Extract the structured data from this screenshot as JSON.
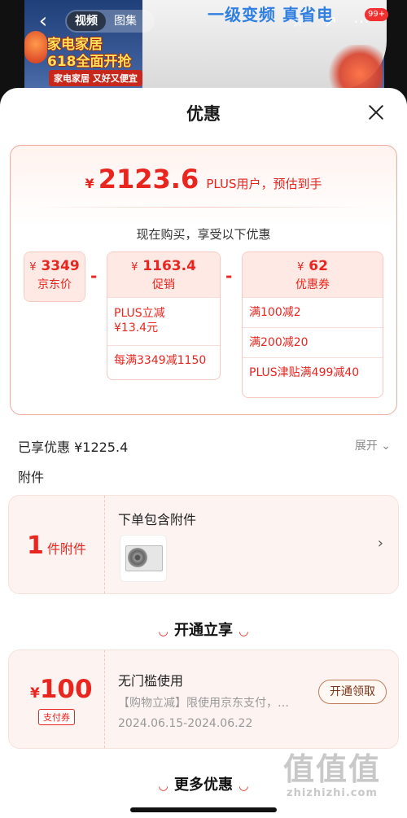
{
  "banner": {
    "slogan": "一级变频  真省电",
    "promo_line1": "家电家居",
    "promo_line2": "618全面开抢",
    "promo_line3": "家电家居  又好又便宜",
    "tab_video": "视频",
    "tab_gallery": "图集",
    "badge_count": "99+"
  },
  "sheet": {
    "title": "优惠"
  },
  "price": {
    "currency": "¥",
    "final": "2123.6",
    "final_tip": "PLUS用户，预估到手",
    "now_buy": "现在购买，享受以下优惠",
    "op_minus": "-",
    "jd": {
      "currency": "¥",
      "value": "3349",
      "label": "京东价"
    },
    "promo": {
      "currency": "¥",
      "value": "1163.4",
      "label": "促销",
      "items": [
        "PLUS立减\n¥13.4元",
        "每满3349减1150"
      ]
    },
    "coupon": {
      "currency": "¥",
      "value": "62",
      "label": "优惠券",
      "items": [
        "满100减2",
        "满200减20",
        "PLUS津贴满499减40"
      ]
    }
  },
  "enjoyed": "已享优惠 ¥1225.4",
  "expand": "展开",
  "attachments": {
    "section_title": "附件",
    "count": "1",
    "count_unit": "件附件",
    "title": "下单包含附件"
  },
  "plus_section": {
    "title": "开通立享"
  },
  "coupon_card": {
    "currency": "¥",
    "amount": "100",
    "tag": "支付券",
    "title": "无门槛使用",
    "desc": "【购物立减】限使用京东支付，…",
    "date": "2024.06.15-2024.06.22",
    "button": "开通领取"
  },
  "more_section": {
    "title": "更多优惠"
  },
  "watermark": {
    "line1": "值值值",
    "line2": "zhizhizhi.com"
  },
  "colors": {
    "accent": "#e8261f",
    "pale": "#fdf4f1"
  }
}
